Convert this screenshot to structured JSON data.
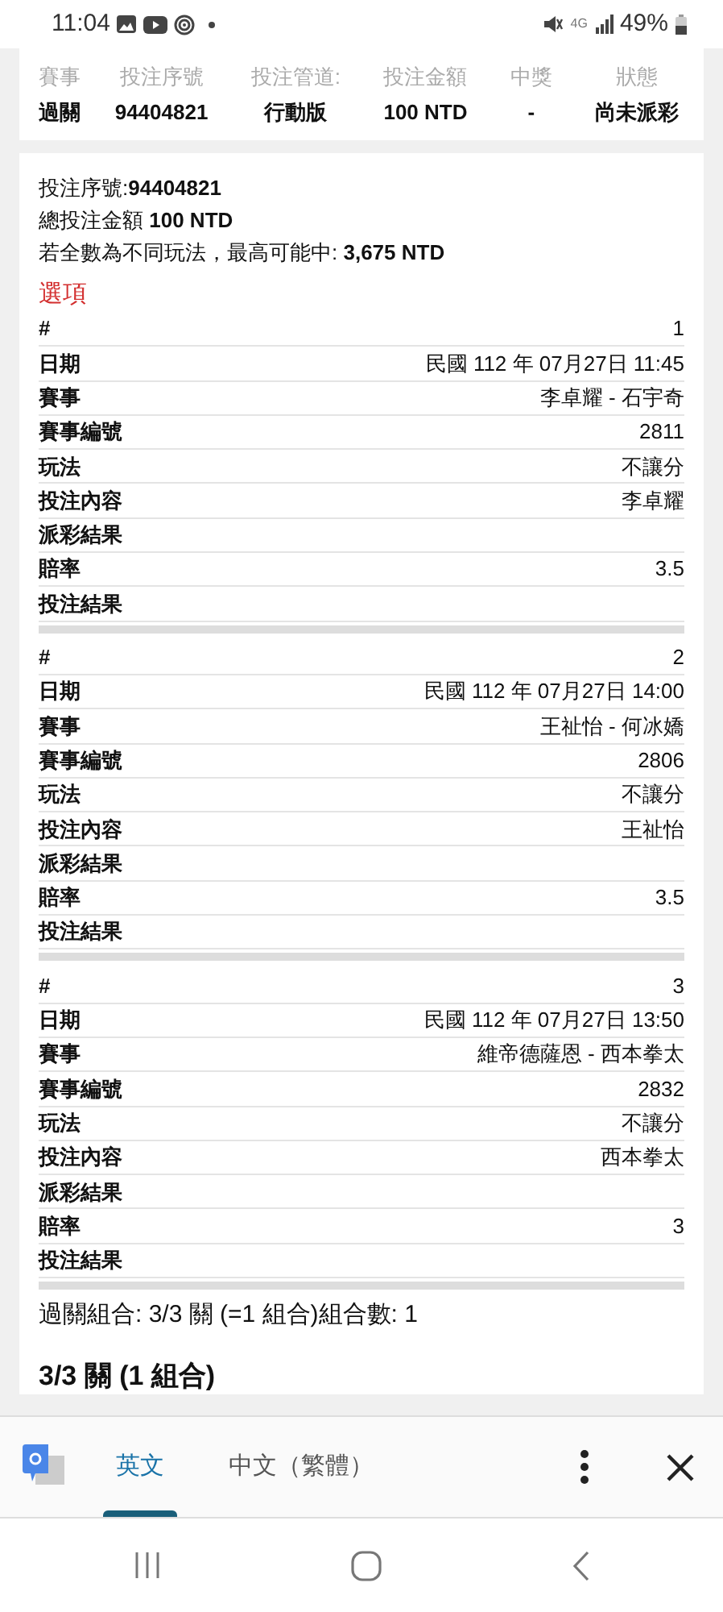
{
  "status_bar": {
    "time": "11:04",
    "battery": "49%",
    "network": "4G"
  },
  "summary_table": {
    "columns": [
      "賽事",
      "投注序號",
      "投注管道:",
      "投注金額",
      "中獎",
      "狀態"
    ],
    "row": [
      "過關",
      "94404821",
      "行動版",
      "100 NTD",
      "-",
      "尚未派彩"
    ]
  },
  "details": [
    "投注序號:**94404821**",
    "總投注金額 **100 NTD**",
    "若全數為不同玩法，最高可能中: **3,675 NTD**"
  ],
  "options_title": "選項",
  "selections": [
    {
      "rows": [
        {
          "label": "#",
          "value": "1"
        },
        {
          "label": "日期",
          "value": "民國 112 年 07月27日 11:45"
        },
        {
          "label": "賽事",
          "value": "李卓耀 - 石宇奇"
        },
        {
          "label": "賽事編號",
          "value": "2811"
        },
        {
          "label": "玩法",
          "value": "不讓分"
        },
        {
          "label": "投注內容",
          "value": "李卓耀"
        },
        {
          "label": "派彩結果"
        },
        {
          "label": "賠率",
          "value": "3.5"
        },
        {
          "label": "投注結果"
        }
      ]
    },
    {
      "rows": [
        {
          "label": "#",
          "value": "2"
        },
        {
          "label": "日期",
          "value": "民國 112 年 07月27日 14:00"
        },
        {
          "label": "賽事",
          "value": "王祉怡 - 何冰嬌"
        },
        {
          "label": "賽事編號",
          "value": "2806"
        },
        {
          "label": "玩法",
          "value": "不讓分"
        },
        {
          "label": "投注內容",
          "value": "王祉怡"
        },
        {
          "label": "派彩結果"
        },
        {
          "label": "賠率",
          "value": "3.5"
        },
        {
          "label": "投注結果"
        }
      ]
    },
    {
      "rows": [
        {
          "label": "#",
          "value": "3"
        },
        {
          "label": "日期",
          "value": "民國 112 年 07月27日 13:50"
        },
        {
          "label": "賽事",
          "value": "維帝德薩恩 - 西本拳太"
        },
        {
          "label": "賽事編號",
          "value": "2832"
        },
        {
          "label": "玩法",
          "value": "不讓分"
        },
        {
          "label": "投注內容",
          "value": "西本拳太"
        },
        {
          "label": "派彩結果"
        },
        {
          "label": "賠率",
          "value": "3"
        },
        {
          "label": "投注結果"
        }
      ]
    }
  ],
  "combination_line": "過關組合: 3/3 關 (=1 組合)組合數: 1",
  "combination_heading": "3/3 關 (1 組合)",
  "translate_bar": {
    "tabs": [
      {
        "label": "英文",
        "selected": true
      },
      {
        "label": "中文（繁體）",
        "selected": false
      }
    ]
  }
}
